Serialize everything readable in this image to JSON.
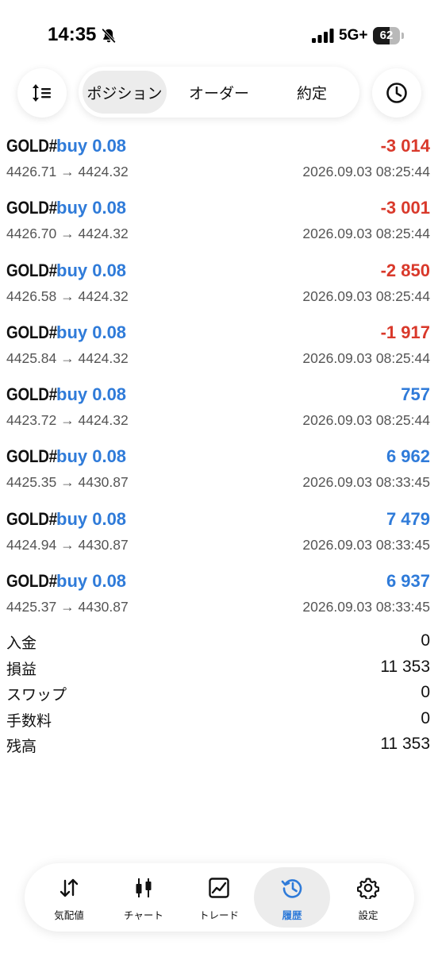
{
  "status_bar": {
    "time": "14:35",
    "network": "5G+",
    "battery_level": "62",
    "battery_fraction": 0.62
  },
  "top_tabs": [
    {
      "label": "ポジション",
      "active": true
    },
    {
      "label": "オーダー",
      "active": false
    },
    {
      "label": "約定",
      "active": false
    }
  ],
  "deals": [
    {
      "symbol": "GOLD#",
      "side": "buy 0.08",
      "profit": "-3 014",
      "prices": "4426.71 → 4424.32",
      "time": "2026.09.03 08:25:44",
      "negative": true
    },
    {
      "symbol": "GOLD#",
      "side": "buy 0.08",
      "profit": "-3 001",
      "prices": "4426.70 → 4424.32",
      "time": "2026.09.03 08:25:44",
      "negative": true
    },
    {
      "symbol": "GOLD#",
      "side": "buy 0.08",
      "profit": "-2 850",
      "prices": "4426.58 → 4424.32",
      "time": "2026.09.03 08:25:44",
      "negative": true
    },
    {
      "symbol": "GOLD#",
      "side": "buy 0.08",
      "profit": "-1 917",
      "prices": "4425.84 → 4424.32",
      "time": "2026.09.03 08:25:44",
      "negative": true
    },
    {
      "symbol": "GOLD#",
      "side": "buy 0.08",
      "profit": "757",
      "prices": "4423.72 → 4424.32",
      "time": "2026.09.03 08:25:44",
      "negative": false
    },
    {
      "symbol": "GOLD#",
      "side": "buy 0.08",
      "profit": "6 962",
      "prices": "4425.35 → 4430.87",
      "time": "2026.09.03 08:33:45",
      "negative": false
    },
    {
      "symbol": "GOLD#",
      "side": "buy 0.08",
      "profit": "7 479",
      "prices": "4424.94 → 4430.87",
      "time": "2026.09.03 08:33:45",
      "negative": false
    },
    {
      "symbol": "GOLD#",
      "side": "buy 0.08",
      "profit": "6 937",
      "prices": "4425.37 → 4430.87",
      "time": "2026.09.03 08:33:45",
      "negative": false
    }
  ],
  "summary": [
    {
      "label": "入金",
      "value": "0"
    },
    {
      "label": "損益",
      "value": "11 353"
    },
    {
      "label": "スワップ",
      "value": "0"
    },
    {
      "label": "手数料",
      "value": "0"
    },
    {
      "label": "残高",
      "value": "11 353"
    }
  ],
  "bottom_tabs": [
    {
      "label": "気配値",
      "icon": "quotes-arrows-icon",
      "active": false
    },
    {
      "label": "チャート",
      "icon": "candlestick-chart-icon",
      "active": false
    },
    {
      "label": "トレード",
      "icon": "trade-chart-icon",
      "active": false
    },
    {
      "label": "履歴",
      "icon": "history-icon",
      "active": true
    },
    {
      "label": "設定",
      "icon": "gear-icon",
      "active": false
    }
  ],
  "colors": {
    "profit_negative": "#d9392b",
    "profit_positive": "#2f7bd9",
    "active_tab": "#2f7bd9",
    "active_bg": "#ececec"
  }
}
